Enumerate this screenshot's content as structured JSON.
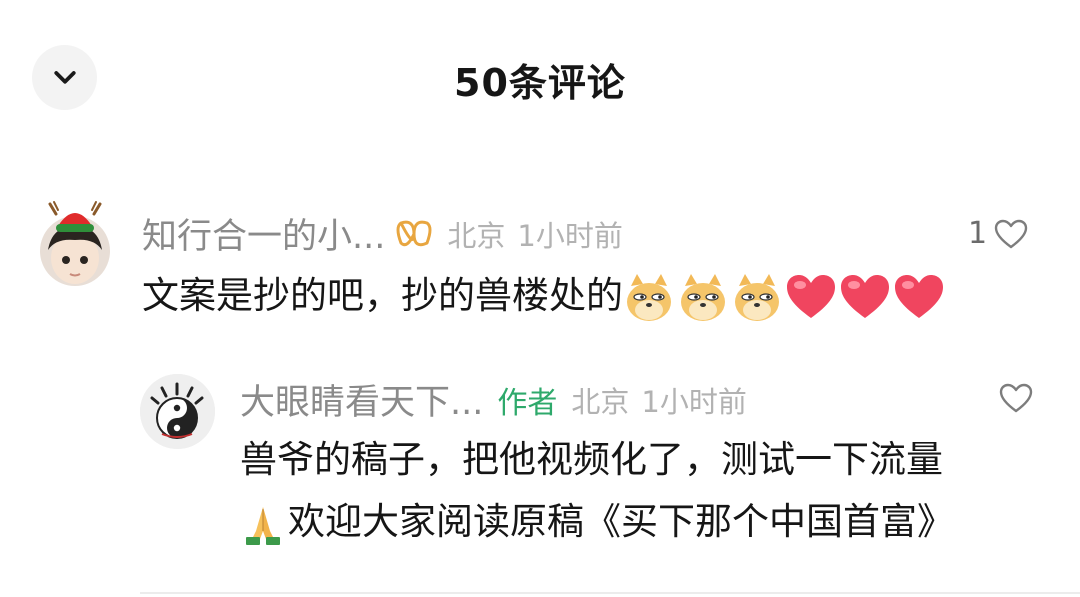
{
  "header": {
    "title": "50条评论",
    "collapse_icon": "chevron-down-icon"
  },
  "comments": [
    {
      "username": "知行合一的小...",
      "badge_icon": "infinity-badge-icon",
      "location": "北京",
      "time": "1小时前",
      "text": "文案是抄的吧，抄的兽楼处的",
      "emojis": [
        "doge-emoji",
        "doge-emoji",
        "doge-emoji",
        "heart-emoji",
        "heart-emoji",
        "heart-emoji"
      ],
      "like_count": "1",
      "avatar": "child-avatar-with-santa-hat"
    },
    {
      "username": "大眼睛看天下...",
      "author_tag": "作者",
      "location": "北京",
      "time": "1小时前",
      "text_line1": "兽爷的稿子，把他视频化了，测试一下流量",
      "text_line2": "欢迎大家阅读原稿《买下那个中国首富》",
      "line2_emoji": "praying-hands-emoji",
      "like_count": "",
      "avatar": "yin-yang-eye-avatar"
    }
  ],
  "colors": {
    "username": "#8a8a8a",
    "meta": "#b2b2b2",
    "author_tag": "#2ea96b",
    "text": "#161616",
    "heart_emoji": "#f0455f",
    "doge": "#f5c56a"
  }
}
